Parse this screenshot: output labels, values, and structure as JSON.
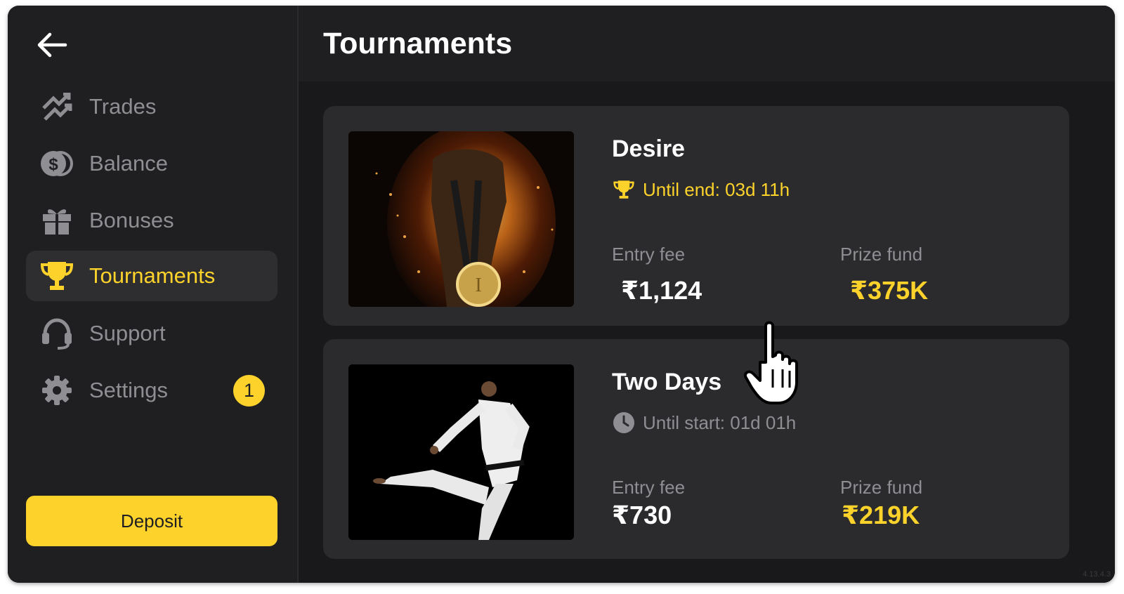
{
  "colors": {
    "accent": "#fdd32b",
    "muted": "#8e8e93",
    "background": "#1f1f21",
    "card": "#2b2b2e"
  },
  "sidebar": {
    "items": [
      {
        "label": "Trades",
        "icon": "trades-arrows-icon"
      },
      {
        "label": "Balance",
        "icon": "coin-stack-icon"
      },
      {
        "label": "Bonuses",
        "icon": "gift-icon"
      },
      {
        "label": "Tournaments",
        "icon": "trophy-icon",
        "active": true
      },
      {
        "label": "Support",
        "icon": "headset-icon"
      },
      {
        "label": "Settings",
        "icon": "gear-icon",
        "badge": "1"
      }
    ],
    "deposit_label": "Deposit"
  },
  "main": {
    "title": "Tournaments",
    "tournaments": [
      {
        "name": "Desire",
        "status": "Until end: 03d 11h",
        "status_icon": "trophy-icon",
        "entry_fee_label": "Entry fee",
        "entry_fee": "₹1,124",
        "prize_label": "Prize fund",
        "prize": "₹375K",
        "image": "flaming fist holding medal"
      },
      {
        "name": "Two Days",
        "status": "Until start: 01d 01h",
        "status_icon": "clock-icon",
        "entry_fee_label": "Entry fee",
        "entry_fee": "₹730",
        "prize_label": "Prize fund",
        "prize": "₹219K",
        "image": "martial artist flying kick"
      }
    ]
  },
  "version": "4.13.4.3"
}
